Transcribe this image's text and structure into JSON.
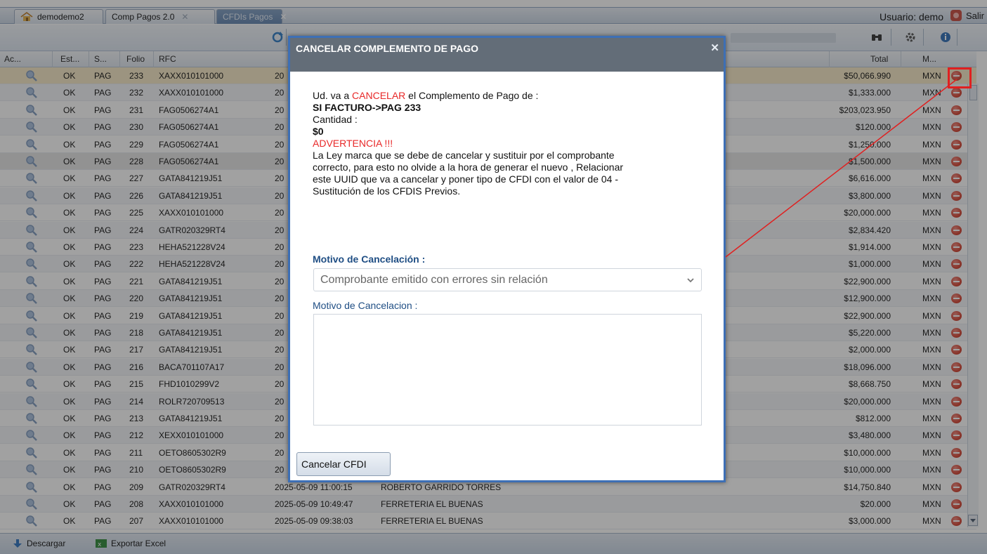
{
  "tabs": [
    {
      "label": "demodemo2",
      "active": false,
      "closable": false
    },
    {
      "label": "Comp Pagos 2.0",
      "active": false,
      "closable": true
    },
    {
      "label": "CFDIs Pagos",
      "active": true,
      "closable": true
    }
  ],
  "user_label": "Usuario: demo",
  "logout_label": "Salir",
  "grid": {
    "columns": [
      "Ac...",
      "Est...",
      "S...",
      "Folio",
      "RFC",
      "Total",
      "M..."
    ],
    "rows": [
      {
        "est": "OK",
        "s": "PAG",
        "folio": "233",
        "rfc": "XAXX010101000",
        "date": "20",
        "name": "",
        "total": "$50,066.990",
        "m": "MXN"
      },
      {
        "est": "OK",
        "s": "PAG",
        "folio": "232",
        "rfc": "XAXX010101000",
        "date": "20",
        "name": "",
        "total": "$1,333.000",
        "m": "MXN"
      },
      {
        "est": "OK",
        "s": "PAG",
        "folio": "231",
        "rfc": "FAG0506274A1",
        "date": "20",
        "name": "",
        "total": "$203,023.950",
        "m": "MXN"
      },
      {
        "est": "OK",
        "s": "PAG",
        "folio": "230",
        "rfc": "FAG0506274A1",
        "date": "20",
        "name": "",
        "total": "$120.000",
        "m": "MXN"
      },
      {
        "est": "OK",
        "s": "PAG",
        "folio": "229",
        "rfc": "FAG0506274A1",
        "date": "20",
        "name": "",
        "total": "$1,250.000",
        "m": "MXN"
      },
      {
        "est": "OK",
        "s": "PAG",
        "folio": "228",
        "rfc": "FAG0506274A1",
        "date": "20",
        "name": "",
        "total": "$1,500.000",
        "m": "MXN"
      },
      {
        "est": "OK",
        "s": "PAG",
        "folio": "227",
        "rfc": "GATA841219J51",
        "date": "20",
        "name": "",
        "total": "$6,616.000",
        "m": "MXN"
      },
      {
        "est": "OK",
        "s": "PAG",
        "folio": "226",
        "rfc": "GATA841219J51",
        "date": "20",
        "name": "",
        "total": "$3,800.000",
        "m": "MXN"
      },
      {
        "est": "OK",
        "s": "PAG",
        "folio": "225",
        "rfc": "XAXX010101000",
        "date": "20",
        "name": "",
        "total": "$20,000.000",
        "m": "MXN"
      },
      {
        "est": "OK",
        "s": "PAG",
        "folio": "224",
        "rfc": "GATR020329RT4",
        "date": "20",
        "name": "",
        "total": "$2,834.420",
        "m": "MXN"
      },
      {
        "est": "OK",
        "s": "PAG",
        "folio": "223",
        "rfc": "HEHA521228V24",
        "date": "20",
        "name": "",
        "total": "$1,914.000",
        "m": "MXN"
      },
      {
        "est": "OK",
        "s": "PAG",
        "folio": "222",
        "rfc": "HEHA521228V24",
        "date": "20",
        "name": "",
        "total": "$1,000.000",
        "m": "MXN"
      },
      {
        "est": "OK",
        "s": "PAG",
        "folio": "221",
        "rfc": "GATA841219J51",
        "date": "20",
        "name": "",
        "total": "$22,900.000",
        "m": "MXN"
      },
      {
        "est": "OK",
        "s": "PAG",
        "folio": "220",
        "rfc": "GATA841219J51",
        "date": "20",
        "name": "",
        "total": "$12,900.000",
        "m": "MXN"
      },
      {
        "est": "OK",
        "s": "PAG",
        "folio": "219",
        "rfc": "GATA841219J51",
        "date": "20",
        "name": "",
        "total": "$22,900.000",
        "m": "MXN"
      },
      {
        "est": "OK",
        "s": "PAG",
        "folio": "218",
        "rfc": "GATA841219J51",
        "date": "20",
        "name": "",
        "total": "$5,220.000",
        "m": "MXN"
      },
      {
        "est": "OK",
        "s": "PAG",
        "folio": "217",
        "rfc": "GATA841219J51",
        "date": "20",
        "name": "",
        "total": "$2,000.000",
        "m": "MXN"
      },
      {
        "est": "OK",
        "s": "PAG",
        "folio": "216",
        "rfc": "BACA701107A17",
        "date": "20",
        "name": "",
        "total": "$18,096.000",
        "m": "MXN"
      },
      {
        "est": "OK",
        "s": "PAG",
        "folio": "215",
        "rfc": "FHD1010299V2",
        "date": "20",
        "name": "",
        "total": "$8,668.750",
        "m": "MXN"
      },
      {
        "est": "OK",
        "s": "PAG",
        "folio": "214",
        "rfc": "ROLR720709513",
        "date": "20",
        "name": "",
        "total": "$20,000.000",
        "m": "MXN"
      },
      {
        "est": "OK",
        "s": "PAG",
        "folio": "213",
        "rfc": "GATA841219J51",
        "date": "20",
        "name": "",
        "total": "$812.000",
        "m": "MXN"
      },
      {
        "est": "OK",
        "s": "PAG",
        "folio": "212",
        "rfc": "XEXX010101000",
        "date": "20",
        "name": "",
        "total": "$3,480.000",
        "m": "MXN"
      },
      {
        "est": "OK",
        "s": "PAG",
        "folio": "211",
        "rfc": "OETO8605302R9",
        "date": "20",
        "name": "",
        "total": "$10,000.000",
        "m": "MXN"
      },
      {
        "est": "OK",
        "s": "PAG",
        "folio": "210",
        "rfc": "OETO8605302R9",
        "date": "20",
        "name": "",
        "total": "$10,000.000",
        "m": "MXN"
      },
      {
        "est": "OK",
        "s": "PAG",
        "folio": "209",
        "rfc": "GATR020329RT4",
        "date": "2025-05-09 11:00:15",
        "name": "ROBERTO GARRIDO TORRES",
        "total": "$14,750.840",
        "m": "MXN"
      },
      {
        "est": "OK",
        "s": "PAG",
        "folio": "208",
        "rfc": "XAXX010101000",
        "date": "2025-05-09 10:49:47",
        "name": "FERRETERIA EL BUENAS",
        "total": "$20.000",
        "m": "MXN"
      },
      {
        "est": "OK",
        "s": "PAG",
        "folio": "207",
        "rfc": "XAXX010101000",
        "date": "2025-05-09 09:38:03",
        "name": "FERRETERIA EL BUENAS",
        "total": "$3,000.000",
        "m": "MXN"
      }
    ]
  },
  "statusbar": {
    "download_label": "Descargar",
    "export_label": "Exportar Excel"
  },
  "modal": {
    "title": "CANCELAR COMPLEMENTO DE PAGO",
    "close_glyph": "✕",
    "line1_pre": "Ud. va a ",
    "line1_red": "CANCELAR",
    "line1_post": " el Complemento de Pago de :",
    "doc_ref": "SI FACTURO->PAG 233",
    "qty_label": "Cantidad :",
    "qty_value": "$0",
    "warning": "ADVERTENCIA !!!",
    "body_lines": [
      "La Ley marca que se debe de cancelar y sustituir por el comprobante",
      "correcto, para esto no olvide a la hora de generar el nuevo , Relacionar",
      "este UUID que va a cancelar y poner tipo de CFDI con el valor de 04 -",
      "Sustitución de los CFDIS Previos."
    ],
    "reason_label": "Motivo de Cancelación :",
    "reason_selected": "Comprobante emitido con errores sin relación",
    "reason_text_label": "Motivo de Cancelacion :",
    "reason_text_value": "",
    "submit_label": "Cancelar CFDI"
  },
  "colors": {
    "accent_border": "#3d6fb5",
    "modal_header": "#636d78",
    "warning_red": "#e82828",
    "highlight_red": "#e02020",
    "selected_row": "#f6e9c6"
  },
  "icons": [
    "home-icon",
    "close-icon",
    "user-logout-icon",
    "refresh-icon",
    "binoculars-icon",
    "settings-icon",
    "info-icon",
    "magnifier-icon",
    "cancel-icon",
    "chevron-down-icon",
    "download-icon",
    "excel-icon"
  ]
}
